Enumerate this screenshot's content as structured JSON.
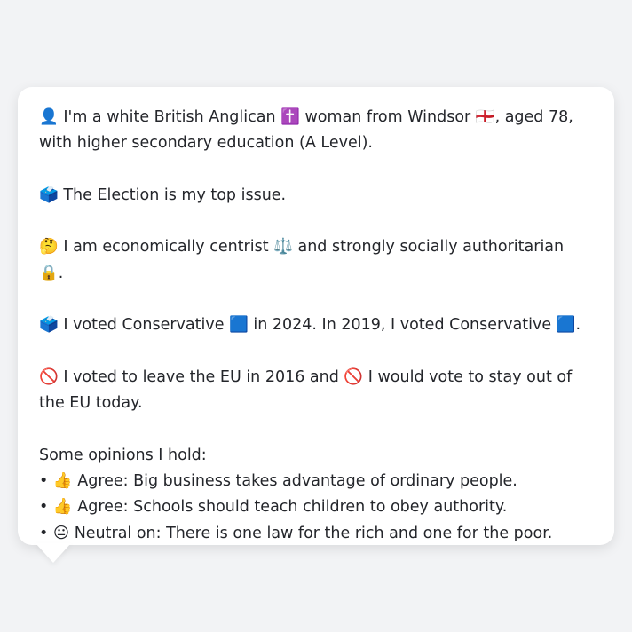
{
  "message": {
    "intro": "👤 I'm a white British Anglican ✝️ woman from Windsor 🏴󠁧󠁢󠁥󠁮󠁧󠁿, aged 78, with higher secondary education (A Level).",
    "top_issue": "🗳️ The Election is my top issue.",
    "ideology": "🤔 I am economically centrist ⚖️ and strongly socially authoritarian 🔒.",
    "votes": "🗳️ I voted Conservative 🟦 in 2024. In 2019, I voted Conservative 🟦.",
    "eu": "🚫 I voted to leave the EU in 2016 and 🚫 I would vote to stay out of the EU today.",
    "opinions_heading": "Some opinions I hold:",
    "opinions": [
      "• 👍 Agree: Big business takes advantage of ordinary people.",
      "• 👍 Agree: Schools should teach children to obey authority.",
      "• 😐 Neutral on: There is one law for the rich and one for the poor."
    ]
  }
}
